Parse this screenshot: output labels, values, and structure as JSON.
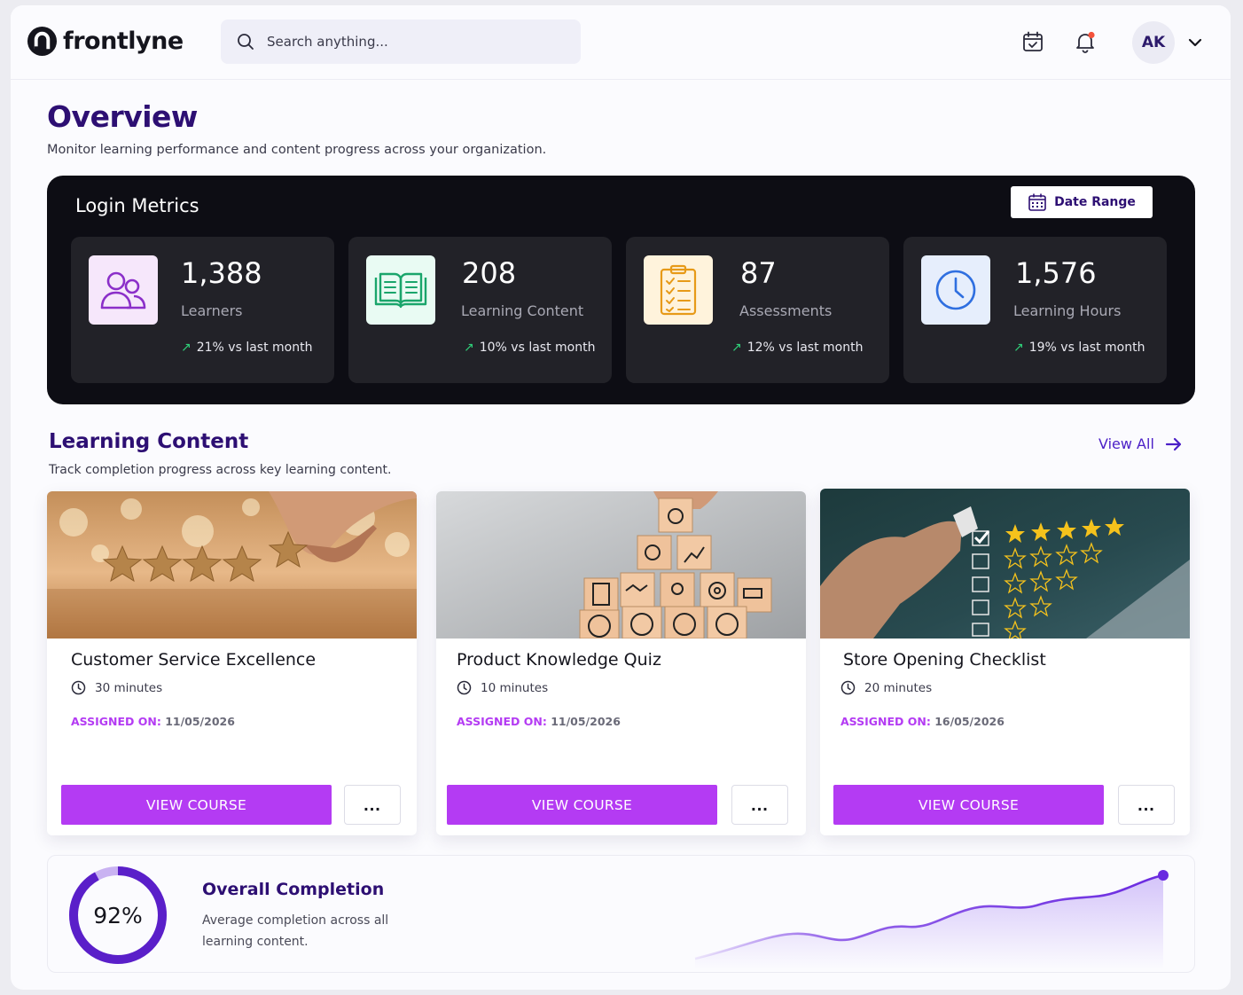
{
  "brand": {
    "name": "frontlyne"
  },
  "search": {
    "placeholder": "Search anything..."
  },
  "user": {
    "initials": "AK"
  },
  "overview": {
    "title": "Overview",
    "subtitle": "Monitor learning performance and content progress across your organization."
  },
  "login_metrics": {
    "title": "Login Metrics",
    "date_range_label": "Date Range",
    "cards": [
      {
        "value": "1,388",
        "label": "Learners",
        "trend": "21% vs last month",
        "icon": "users-icon",
        "icon_bg": "#f6e7fb",
        "icon_color": "#8b2fc9"
      },
      {
        "value": "208",
        "label": "Learning Content",
        "trend": "10% vs last month",
        "icon": "open-book-icon",
        "icon_bg": "#e9fbf3",
        "icon_color": "#1aa56b"
      },
      {
        "value": "87",
        "label": "Assessments",
        "trend": "12% vs last month",
        "icon": "clipboard-checklist-icon",
        "icon_bg": "#fff3dc",
        "icon_color": "#e79a18"
      },
      {
        "value": "1,576",
        "label": "Learning Hours",
        "trend": "19% vs last month",
        "icon": "clock-icon",
        "icon_bg": "#e6eefc",
        "icon_color": "#2f6fe0"
      }
    ]
  },
  "learning_content": {
    "title": "Learning Content",
    "subtitle": "Track completion progress across key learning content.",
    "view_all_label": "View All",
    "assigned_key": "ASSIGNED ON:",
    "view_button_label": "VIEW COURSE",
    "more_label": "...",
    "courses": [
      {
        "title": "Customer Service Excellence",
        "duration": "30 minutes",
        "assigned_on": "11/05/2026",
        "image": "stars-rating-photo"
      },
      {
        "title": "Product Knowledge Quiz",
        "duration": "10 minutes",
        "assigned_on": "11/05/2026",
        "image": "wooden-blocks-photo"
      },
      {
        "title": "Store Opening Checklist",
        "duration": "20 minutes",
        "assigned_on": "16/05/2026",
        "image": "checklist-stars-photo"
      }
    ]
  },
  "overall": {
    "percent_label": "92%",
    "percent": 92,
    "title": "Overall Completion",
    "subtitle": "Average completion across all learning content."
  },
  "colors": {
    "brand_purple": "#2d0f73",
    "accent_purple": "#b43bf3",
    "trend_green": "#2fd27a",
    "ring_purple": "#5a1fc9"
  }
}
